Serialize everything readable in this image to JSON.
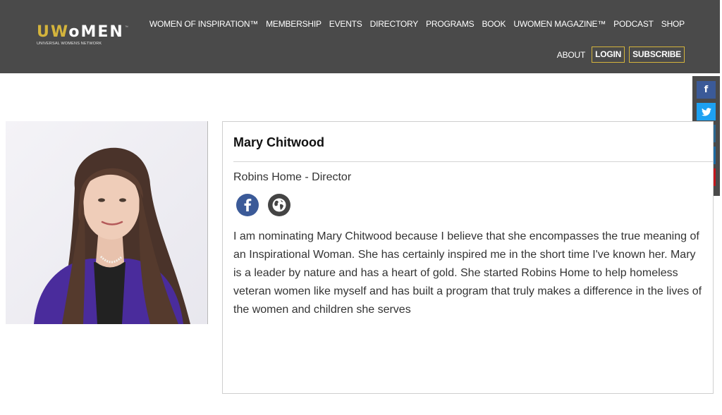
{
  "header": {
    "logo": {
      "word": "UWoMEN",
      "tm": "™",
      "subtitle": "UNIVERSAL WOMENS NETWORK"
    },
    "nav_primary": [
      "WOMEN OF INSPIRATION™",
      "MEMBERSHIP",
      "EVENTS",
      "DIRECTORY",
      "PROGRAMS",
      "BOOK",
      "UWOMEN MAGAZINE™",
      "PODCAST",
      "SHOP"
    ],
    "nav_secondary": {
      "about": "ABOUT",
      "login": "LOGIN",
      "subscribe": "SUBSCRIBE"
    }
  },
  "social_sidebar": [
    {
      "icon": "facebook-icon",
      "glyph": "f",
      "color": "#3b5a98"
    },
    {
      "icon": "twitter-icon",
      "glyph": "",
      "color": "#1da1f2"
    },
    {
      "icon": "instagram-icon",
      "glyph": "",
      "color": "#2b6790"
    },
    {
      "icon": "linkedin-icon",
      "glyph": "in",
      "color": "#1c6ba3"
    },
    {
      "icon": "youtube-icon",
      "glyph": "",
      "color": "#c4161c"
    }
  ],
  "profile": {
    "name": "Mary Chitwood",
    "role": "Robins Home - Director",
    "links": [
      "facebook-icon",
      "globe-icon"
    ],
    "bio": "I am nominating Mary Chitwood because I believe that she encompasses the true meaning of an Inspirational Woman. She has certainly inspired me in the short time I've known her. Mary is a leader by nature and has a heart of gold. She started Robins Home to help homeless veteran women like myself and has built a program that truly makes a difference in the lives of the women and children she serves"
  },
  "colors": {
    "header_bg": "#4a4a4a",
    "accent_gold": "#d4b43c"
  }
}
